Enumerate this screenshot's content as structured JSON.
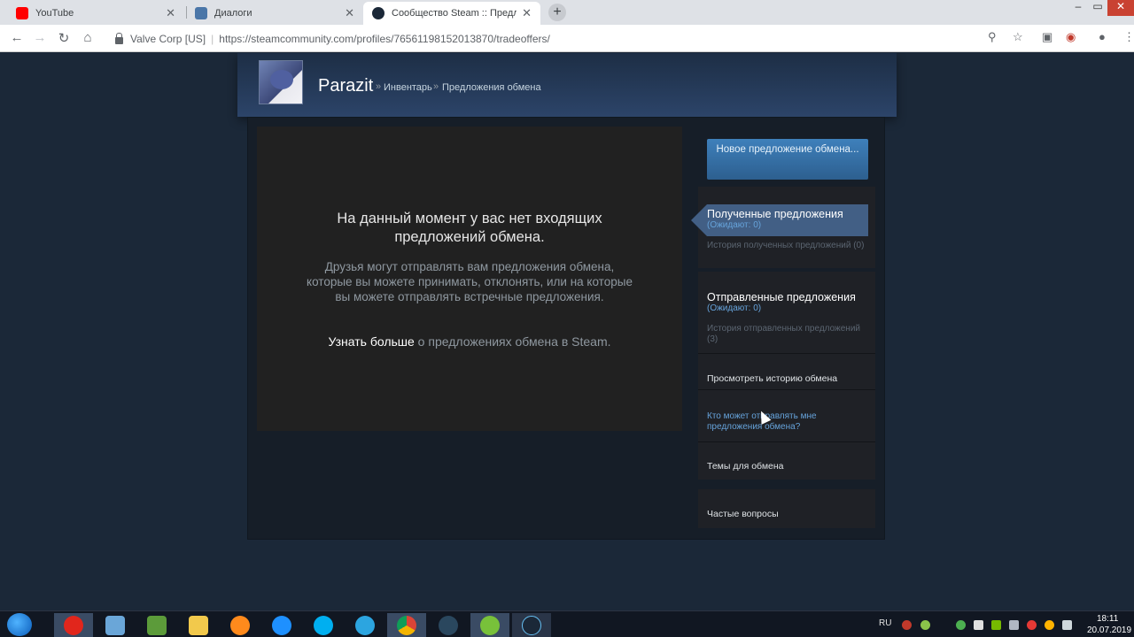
{
  "browser": {
    "tabs": [
      {
        "title": "YouTube",
        "active": false
      },
      {
        "title": "Диалоги",
        "active": false
      },
      {
        "title": "Сообщество Steam :: Предложе",
        "active": true
      }
    ],
    "new_tab_label": "+",
    "cert_label": "Valve Corp [US]",
    "url": "https://steamcommunity.com/profiles/76561198152013870/tradeoffers/",
    "icons": [
      "back-icon",
      "forward-icon",
      "reload-icon",
      "home-icon",
      "zoom-icon",
      "star-icon",
      "extension-icon",
      "account-icon",
      "menu-icon"
    ],
    "window_controls": {
      "minimize": "–",
      "maximize": "▭",
      "close": "✕"
    }
  },
  "profile": {
    "name": "Parazit",
    "breadcrumb": [
      {
        "label": "Инвентарь"
      },
      {
        "label": "Предложения обмена"
      }
    ],
    "breadcrumb_sep": "»"
  },
  "main": {
    "empty_title": "На данный момент у вас нет входящих предложений обмена.",
    "empty_desc": "Друзья могут отправлять вам предложения обмена, которые вы можете принимать, отклонять, или на которые вы можете отправлять встречные предложения.",
    "learn_more_link": "Узнать больше",
    "learn_more_rest": " о предложениях обмена в Steam."
  },
  "sidebar": {
    "new_offer_button": "Новое предложение обмена...",
    "received": {
      "title": "Полученные предложения",
      "pending": "(Ожидают: 0)",
      "history": "История полученных предложений (0)"
    },
    "sent": {
      "title": "Отправленные предложения",
      "pending": "(Ожидают: 0)",
      "history": "История отправленных предложений (3)"
    },
    "view_history": "Просмотреть историю обмена",
    "who_can_send": "Кто может отправлять мне предложения обмена?",
    "trade_topics": "Темы для обмена",
    "faq": "Частые вопросы"
  },
  "taskbar": {
    "apps": [
      "windows-start-icon",
      "opera-icon",
      "explorer-desktop-icon",
      "minecraft-icon",
      "folder-icon",
      "firefox-icon",
      "ie-icon",
      "skype-icon",
      "telegram-icon",
      "chrome-icon",
      "steam-icon",
      "utorrent-icon",
      "steam-client-icon"
    ],
    "language": "RU",
    "time": "18:11",
    "date": "20.07.2019"
  },
  "colors": {
    "steam_bg": "#1b2838",
    "accent_blue": "#66a3db",
    "button_blue": "#3e80bb",
    "active_tab": "#425f85"
  }
}
